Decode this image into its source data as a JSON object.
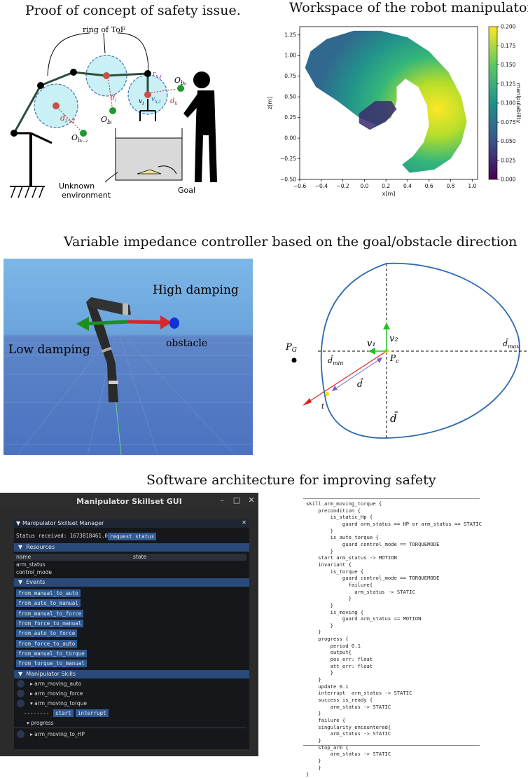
{
  "titles": {
    "proof": "Proof of concept of safety issue.",
    "workspace": "Workspace of the  robot manipulator",
    "impedance": "Variable impedance controller based on the goal/obstacle direction",
    "software": "Software architecture for improving safety"
  },
  "proof_figure": {
    "ring_label": "ring of ToF",
    "unknown_env": "Unknown",
    "unknown_env2": "environment",
    "goal_label": "Goal",
    "d_im2": "d_{i-2}",
    "o_bm2": "O_{b_{i-2}}",
    "d_i": "d_i",
    "o_bi": "O_{b_i}",
    "r_xi": "r_{x,i}",
    "v_i": "v_i",
    "v_xi": "v_{x,i}",
    "d_k": "d_k",
    "o_bk": "O_{b_k}"
  },
  "chart_data": {
    "type": "scatter",
    "title": "Workspace of the  robot manipulator",
    "xlabel": "x[m]",
    "ylabel": "z[m]",
    "xlim": [
      -0.6,
      1.05
    ],
    "ylim": [
      -0.5,
      1.35
    ],
    "xticks": [
      "−0.6",
      "−0.4",
      "−0.2",
      "0.0",
      "0.2",
      "0.4",
      "0.6",
      "0.8",
      "1.0"
    ],
    "yticks": [
      "1.25",
      "1.00",
      "0.75",
      "0.50",
      "0.25",
      "0.00",
      "−0.25",
      "−0.50"
    ],
    "colorbar_label": "manipulability",
    "colorbar_ticks": [
      "0.200",
      "0.175",
      "0.150",
      "0.125",
      "0.100",
      "0.075",
      "0.050",
      "0.025",
      "0.000"
    ],
    "colorbar_range": [
      0.0,
      0.2
    ],
    "colormap": "viridis",
    "grid": false
  },
  "sim_figure": {
    "high_damping": "High damping",
    "low_damping": "Low damping",
    "obstacle": "obstacle"
  },
  "ellipse_figure": {
    "p_g": "P_G",
    "v1": "v₁",
    "v2": "v₂",
    "pc": "P_c",
    "d_max": "d̂_max",
    "d_min": "d̂_min",
    "d_hat": "d̂",
    "t": "t",
    "d_bar": "d̄"
  },
  "gui": {
    "window_title": "Manipulator Skillset GUI",
    "panel_title": "Manipulator Skillset Manager",
    "status_text": "Status received: 1673818461.0",
    "request_status": "request status",
    "resources_header": "Resources",
    "col_name": "name",
    "col_state": "state",
    "resources": [
      "arm_status",
      "control_mode"
    ],
    "events_header": "Events",
    "events": [
      "from_manual_to_auto",
      "from_auto_to_manual",
      "from_manual_to_force",
      "from_force_to_manual",
      "from_auto_to_force",
      "from_force_to_auto",
      "from_manual_to_torque",
      "from_torque_to_manual"
    ],
    "skills_header": "Manipulator Skills",
    "skills": [
      "arm_moving_auto",
      "arm_moving_force",
      "arm_moving_torque"
    ],
    "dashes": "--------",
    "start": "start",
    "interrupt": "interrupt",
    "progress": "progress",
    "last_skill": "arm_moving_to_HP"
  },
  "code_lines": [
    "skill arm_moving_torque {",
    "    precondition {",
    "        is_static_Hp {",
    "            guard arm_status == HP or arm_status == STATIC",
    "        }",
    "        is_auto_torque {",
    "            guard control_mode == TORQUEMODE",
    "        }",
    "    start arm_status -> MOTION",
    "    invariant {",
    "        is_torque {",
    "            guard control_mode == TORQUEMODE",
    "              failure{",
    "                arm_status -> STATIC",
    "              }",
    "        }",
    "        is_moving {",
    "            guard arm_status == MOTION",
    "        }",
    "    }",
    "    progress {",
    "        period 0.1",
    "        output{",
    "        pos_err: float",
    "        att_err: float",
    "        }",
    "    }",
    "    update 0.1",
    "    interrupt  arm_status -> STATIC",
    "    success is_ready {",
    "        arm_status -> STATIC",
    "    }",
    "    failure {",
    "    singularity_encountered{",
    "        arm_status -> STATIC",
    "    }",
    "    stop_arm {",
    "        arm_status -> STATIC",
    "    }",
    "    }",
    "}"
  ]
}
